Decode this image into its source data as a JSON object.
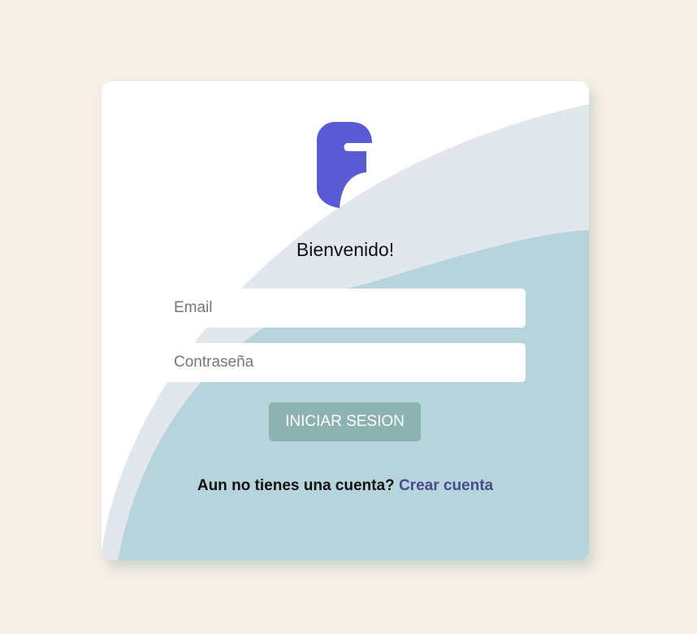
{
  "login": {
    "logo_icon": "brand-logo-icon",
    "title": "Bienvenido!",
    "email": {
      "placeholder": "Email",
      "value": ""
    },
    "password": {
      "placeholder": "Contraseña",
      "value": ""
    },
    "submit_label": "INICIAR SESION",
    "signup_prompt": "Aun no tienes una cuenta?",
    "signup_link": "Crear cuenta"
  },
  "colors": {
    "page_background": "#f6efe6",
    "card_background": "#ffffff",
    "wave_light": "#e2e7ee",
    "wave_teal": "#b6d4dc",
    "logo": "#5a5ad4",
    "button": "#8cb2b1",
    "link": "#4a4a8c"
  }
}
